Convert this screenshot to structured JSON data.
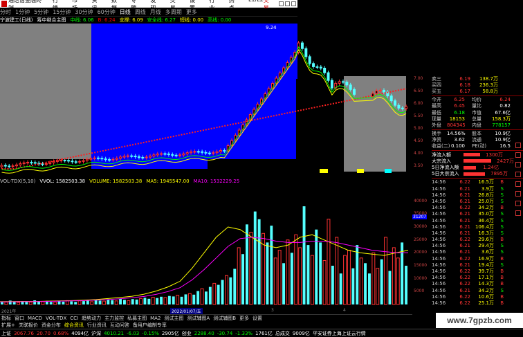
{
  "titlebar": {
    "app": "通达信金融终端",
    "menus": [
      "行情",
      "市场",
      "资讯",
      "数据",
      "专题",
      "发现",
      "交易",
      "设置",
      "行业",
      "热点",
      "L1/L2"
    ],
    "brand": "交易"
  },
  "periods": {
    "items": [
      "分时",
      "1分钟",
      "5分钟",
      "15分钟",
      "30分钟",
      "60分钟",
      "日线",
      "周线",
      "月线",
      "多周期",
      "更多"
    ],
    "selected": 6
  },
  "header": {
    "stock": "宁波建工(日线)",
    "tag": "筹中继合主图",
    "ma1": "中线: 6.06",
    "ma2": "B: 6.24",
    "ma3": "支撑: 6.09",
    "ma4": "安全线: 6.27",
    "ma5": "短线: 0.00",
    "ma6": "高线: 0.00",
    "peak": "9.24"
  },
  "volume_header": {
    "name": "VOL-TDX(5,10)",
    "vvol": "VVOL: 1582503.38",
    "volume": "VOLUME: 1582503.38",
    "ma5": "MA5: 1945547.00",
    "ma10": "MA10: 1532229.25"
  },
  "chart_data": {
    "type": "bar",
    "title": "",
    "xlabel": "",
    "ylabel": "",
    "ylim": [
      0,
      45000
    ],
    "y_ticks": [
      5000,
      10000,
      15000,
      20000,
      25000,
      30000,
      35000,
      40000
    ],
    "values": [
      1200,
      900,
      1500,
      1100,
      800,
      1300,
      1000,
      900,
      1600,
      1200,
      1100,
      1400,
      1000,
      900,
      1300,
      1100,
      1500,
      1200,
      1000,
      1400,
      1300,
      1600,
      1100,
      1800,
      1500,
      1300,
      2000,
      1700,
      1400,
      2200,
      1800,
      1500,
      2100,
      1900,
      2300,
      2600,
      2200,
      2800,
      2500,
      3000,
      2700,
      3300,
      3100,
      3600,
      3000,
      3900,
      4200,
      3800,
      5200,
      6100,
      5000,
      6800,
      8200,
      7600,
      9500,
      11200,
      10500,
      13800,
      22000,
      19500,
      31000,
      28000,
      36000,
      33000,
      27500,
      24000,
      30500,
      18000,
      21000,
      16000,
      25000,
      20000,
      27000,
      22000,
      38000,
      23000,
      19000,
      29000,
      24000,
      17000,
      33000,
      15000,
      26000,
      12000,
      19000,
      21000,
      14000,
      23000,
      18000,
      16000,
      12000,
      20000,
      14000,
      17500,
      26000,
      13000,
      22000,
      18000,
      24000,
      15000
    ],
    "ma5": [
      1100,
      1150,
      1200,
      1180,
      1300,
      1400,
      1500,
      1700,
      1900,
      2300,
      2700,
      3200,
      4000,
      5200,
      6800,
      9000,
      14000,
      20000,
      26000,
      30000,
      29000,
      26000,
      23000,
      22000,
      23000,
      26000,
      27000,
      25000,
      23000,
      21000,
      20000,
      19500,
      19000,
      20000,
      21000
    ],
    "ma10": [
      1000,
      1050,
      1100,
      1150,
      1200,
      1300,
      1400,
      1500,
      1700,
      1900,
      2200,
      2600,
      3100,
      3900,
      5000,
      6500,
      9500,
      13500,
      18000,
      22500,
      25500,
      26000,
      25500,
      24500,
      24000,
      24000,
      24500,
      24500,
      24000,
      23000,
      22000,
      21000,
      20500,
      20000,
      20000
    ],
    "colors": {
      "up": "#54ffff",
      "down": "#ff3232",
      "ma5": "#ffff00",
      "ma10": "#ff00ff"
    }
  },
  "price_axis": [
    "7.00",
    "6.50",
    "6.00",
    "5.50",
    "5.00",
    "4.50",
    "4.00",
    "3.50"
  ],
  "vol_axis_label": "31207",
  "dates": {
    "left": "2021年",
    "cur": "2022/01/07/五",
    "mid": "3",
    "right": "4"
  },
  "indicators": [
    "指标",
    "窗口",
    "MACD",
    "VOL-TDX",
    "CCI",
    "趋势动力",
    "主力监控",
    "私募主图",
    "MA2",
    "测试主图",
    "测试辅图A",
    "测试辅图B",
    "更多",
    "设置"
  ],
  "tabs": {
    "items": [
      "扩展+",
      "关联报价",
      "资金分布",
      "综合资讯",
      "行业资讯",
      "互动问答",
      "备用户编制专率"
    ],
    "selected": 3
  },
  "status": {
    "sh_label": "上证",
    "sh_val": "3067.76",
    "sh_chg": "20.70",
    "sh_pct": "0.68%",
    "sh_amt": "4094亿",
    "hs_label": "沪深",
    "hs_val": "4010.21",
    "hs_chg": "-6.03",
    "hs_pct": "-0.15%",
    "hs_amt": "2905亿",
    "cy_label": "创业",
    "cy_val": "2288.40",
    "cy_chg": "-30.74",
    "cy_pct": "-1.33%",
    "cy_amt": "1761亿",
    "total_label": "总成交",
    "total_val": "9009亿",
    "server": "平安证券上海上证云行情"
  },
  "orderbook": [
    {
      "label": "卖三",
      "price": "6.19",
      "qty": "138.7万"
    },
    {
      "label": "买四",
      "price": "6.18",
      "qty": "236.3万"
    },
    {
      "label": "买五",
      "price": "6.17",
      "qty": "58.8万"
    }
  ],
  "stats": [
    {
      "l1": "今开",
      "v1": "6.25",
      "c1": "red",
      "l2": "均价",
      "v2": "6.24",
      "c2": "red"
    },
    {
      "l1": "最高",
      "v1": "6.45",
      "c1": "red",
      "l2": "量比",
      "v2": "0.82",
      "c2": "wht"
    },
    {
      "l1": "最低",
      "v1": "6.18",
      "c1": "grn",
      "l2": "市值",
      "v2": "67.6亿",
      "c2": "wht"
    },
    {
      "l1": "现量",
      "v1": "18153",
      "c1": "yel",
      "l2": "总量",
      "v2": "158.3万",
      "c2": "yel"
    },
    {
      "l1": "外盘",
      "v1": "804345",
      "c1": "red",
      "l2": "内盘",
      "v2": "778157",
      "c2": "grn"
    }
  ],
  "stats2": [
    {
      "l1": "换手",
      "v1": "14.56%",
      "c1": "wht",
      "l2": "股本",
      "v2": "10.9亿",
      "c2": "wht"
    },
    {
      "l1": "净资",
      "v1": "3.62",
      "c1": "wht",
      "l2": "流通",
      "v2": "10.9亿",
      "c2": "wht"
    },
    {
      "l1": "收益(二)",
      "v1": "0.100",
      "c1": "wht",
      "l2": "PE(动)",
      "v2": "16.5",
      "c2": "wht"
    }
  ],
  "flows": [
    {
      "label": "净流入额",
      "value": "1300万",
      "fill": 0.55
    },
    {
      "label": "大宗流入",
      "value": "2427万",
      "fill": 0.9
    },
    {
      "label": "5日净流入额",
      "value": "1.24亿",
      "fill": 0.4
    },
    {
      "label": "5日大宗流入",
      "value": "7895万",
      "fill": 0.7
    }
  ],
  "ticks": [
    {
      "t": "14:56",
      "p": "6.22",
      "q": "16.5万",
      "s": "B",
      "c": "red"
    },
    {
      "t": "14:56",
      "p": "6.21",
      "q": "3.9万",
      "s": "S",
      "c": "grn"
    },
    {
      "t": "14:56",
      "p": "6.21",
      "q": "26.8万",
      "s": "S",
      "c": "grn"
    },
    {
      "t": "14:56",
      "p": "6.21",
      "q": "25.0万",
      "s": "S",
      "c": "grn"
    },
    {
      "t": "14:56",
      "p": "6.22",
      "q": "34.2万",
      "s": "B",
      "c": "red"
    },
    {
      "t": "14:56",
      "p": "6.21",
      "q": "35.0万",
      "s": "S",
      "c": "grn"
    },
    {
      "t": "14:56",
      "p": "6.21",
      "q": "36.4万",
      "s": "S",
      "c": "grn"
    },
    {
      "t": "14:56",
      "p": "6.21",
      "q": "106.4万",
      "s": "S",
      "c": "grn"
    },
    {
      "t": "14:56",
      "p": "6.21",
      "q": "16.3万",
      "s": "S",
      "c": "grn"
    },
    {
      "t": "14:56",
      "p": "6.22",
      "q": "29.6万",
      "s": "B",
      "c": "red"
    },
    {
      "t": "14:56",
      "p": "6.21",
      "q": "29.4万",
      "s": "S",
      "c": "grn"
    },
    {
      "t": "14:56",
      "p": "6.21",
      "q": "3.6万",
      "s": "S",
      "c": "grn"
    },
    {
      "t": "14:56",
      "p": "6.22",
      "q": "16.9万",
      "s": "B",
      "c": "red"
    },
    {
      "t": "14:56",
      "p": "6.21",
      "q": "19.4万",
      "s": "S",
      "c": "grn"
    },
    {
      "t": "14:56",
      "p": "6.22",
      "q": "39.7万",
      "s": "B",
      "c": "red"
    },
    {
      "t": "14:56",
      "p": "6.22",
      "q": "17.1万",
      "s": "B",
      "c": "red"
    },
    {
      "t": "14:56",
      "p": "6.22",
      "q": "14.3万",
      "s": "B",
      "c": "red"
    },
    {
      "t": "14:56",
      "p": "6.21",
      "q": "34.2万",
      "s": "S",
      "c": "grn"
    },
    {
      "t": "14:56",
      "p": "6.22",
      "q": "10.6万",
      "s": "B",
      "c": "red"
    },
    {
      "t": "14:56",
      "p": "6.22",
      "q": "25.1万",
      "s": "B",
      "c": "red"
    }
  ],
  "watermark": "www.7gpzb.com"
}
